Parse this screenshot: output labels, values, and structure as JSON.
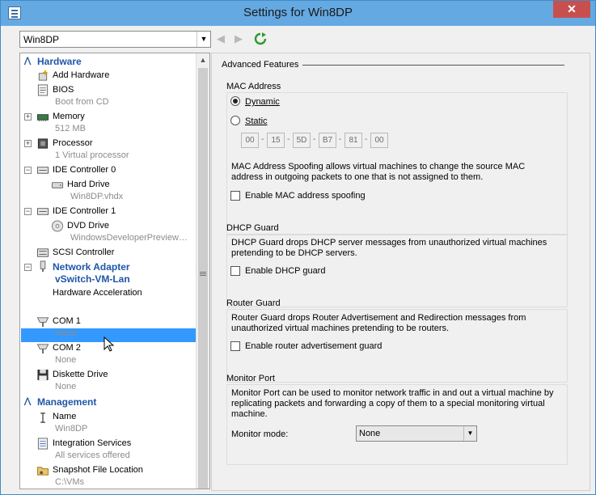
{
  "window": {
    "title": "Settings for Win8DP",
    "close": "✕"
  },
  "toolbar": {
    "vm_name": "Win8DP"
  },
  "tree": {
    "hardware": "Hardware",
    "add_hardware": "Add Hardware",
    "bios": "BIOS",
    "bios_sub": "Boot from CD",
    "memory": "Memory",
    "memory_sub": "512 MB",
    "processor": "Processor",
    "processor_sub": "1 Virtual processor",
    "ide0": "IDE Controller 0",
    "hard_drive": "Hard Drive",
    "hard_drive_sub": "Win8DP.vhdx",
    "ide1": "IDE Controller 1",
    "dvd_drive": "DVD Drive",
    "dvd_drive_sub": "WindowsDeveloperPreview…",
    "scsi": "SCSI Controller",
    "network_adapter": "Network Adapter",
    "network_adapter_sub": "vSwitch-VM-Lan",
    "hw_accel": "Hardware Acceleration",
    "adv_features": "Advanced Features",
    "com1": "COM 1",
    "com1_sub": "None",
    "com2": "COM 2",
    "com2_sub": "None",
    "diskette": "Diskette Drive",
    "diskette_sub": "None",
    "management": "Management",
    "name": "Name",
    "name_sub": "Win8DP",
    "integration": "Integration Services",
    "integration_sub": "All services offered",
    "snapshot": "Snapshot File Location",
    "snapshot_sub": "C:\\VMs"
  },
  "content": {
    "heading": "Advanced Features",
    "mac": {
      "group": "MAC Address",
      "dynamic": "Dynamic",
      "static": "Static",
      "octets": [
        "00",
        "15",
        "5D",
        "B7",
        "81",
        "00"
      ],
      "separator": "-",
      "desc": "MAC Address Spoofing allows virtual machines to change the source MAC address in outgoing packets to one that is not assigned to them.",
      "spoof_label": "Enable MAC address spoofing"
    },
    "dhcp": {
      "group": "DHCP Guard",
      "desc": "DHCP Guard drops DHCP server messages from unauthorized virtual machines pretending to be DHCP servers.",
      "label": "Enable DHCP guard"
    },
    "router": {
      "group": "Router Guard",
      "desc": "Router Guard drops Router Advertisement and Redirection messages from unauthorized virtual machines pretending to be routers.",
      "label": "Enable router advertisement guard"
    },
    "monitor": {
      "group": "Monitor Port",
      "desc": "Monitor Port can be used to monitor network traffic in and out a virtual machine by replicating packets and forwarding a copy of them to a special monitoring virtual machine.",
      "mode_label": "Monitor mode:",
      "mode_value": "None"
    }
  }
}
